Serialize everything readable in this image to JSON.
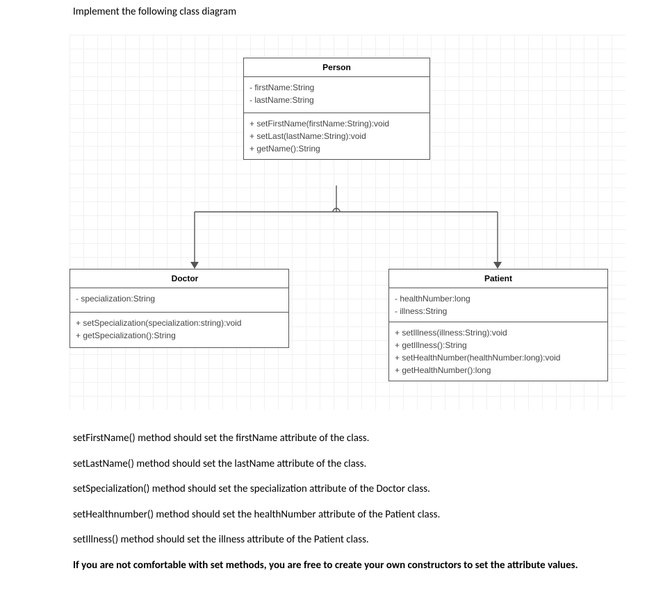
{
  "heading": "Implement the following class diagram",
  "classes": {
    "person": {
      "name": "Person",
      "attributes": [
        "- firstName:String",
        "- lastName:String"
      ],
      "methods": [
        "+ setFirstName(firstName:String):void",
        "+ setLast(lastName:String):void",
        "+ getName():String"
      ]
    },
    "doctor": {
      "name": "Doctor",
      "attributes": [
        "- specialization:String"
      ],
      "methods": [
        "+ setSpecialization(specialization:string):void",
        "+ getSpecialization():String"
      ]
    },
    "patient": {
      "name": "Patient",
      "attributes": [
        "- healthNumber:long",
        "- illness:String"
      ],
      "methods": [
        "+ setIllness(illness:String):void",
        "+ getIllness():String",
        "+ setHealthNumber(healthNumber:long):void",
        "+ getHealthNumber():long"
      ]
    }
  },
  "relationships": [
    {
      "from": "Doctor",
      "to": "Person",
      "kind": "inheritance"
    },
    {
      "from": "Patient",
      "to": "Person",
      "kind": "inheritance"
    }
  ],
  "description": {
    "p1": "setFirstName() method should set the firstName attribute of the class.",
    "p2": "setLastName() method should set the lastName attribute of the class.",
    "p3": "setSpecialization() method should set the specialization attribute of the Doctor class.",
    "p4": "setHealthnumber() method should set the healthNumber attribute of the Patient class.",
    "p5": "setIllness() method should set the illness attribute of the Patient class.",
    "p6": "If you are not comfortable with set methods, you are free to create your own constructors to set the attribute values."
  },
  "chart_data": {
    "type": "uml_class_diagram",
    "classes": [
      {
        "name": "Person",
        "attributes": [
          {
            "visibility": "private",
            "name": "firstName",
            "type": "String"
          },
          {
            "visibility": "private",
            "name": "lastName",
            "type": "String"
          }
        ],
        "methods": [
          {
            "visibility": "public",
            "name": "setFirstName",
            "params": [
              {
                "name": "firstName",
                "type": "String"
              }
            ],
            "return": "void"
          },
          {
            "visibility": "public",
            "name": "setLast",
            "params": [
              {
                "name": "lastName",
                "type": "String"
              }
            ],
            "return": "void"
          },
          {
            "visibility": "public",
            "name": "getName",
            "params": [],
            "return": "String"
          }
        ]
      },
      {
        "name": "Doctor",
        "extends": "Person",
        "attributes": [
          {
            "visibility": "private",
            "name": "specialization",
            "type": "String"
          }
        ],
        "methods": [
          {
            "visibility": "public",
            "name": "setSpecialization",
            "params": [
              {
                "name": "specialization",
                "type": "string"
              }
            ],
            "return": "void"
          },
          {
            "visibility": "public",
            "name": "getSpecialization",
            "params": [],
            "return": "String"
          }
        ]
      },
      {
        "name": "Patient",
        "extends": "Person",
        "attributes": [
          {
            "visibility": "private",
            "name": "healthNumber",
            "type": "long"
          },
          {
            "visibility": "private",
            "name": "illness",
            "type": "String"
          }
        ],
        "methods": [
          {
            "visibility": "public",
            "name": "setIllness",
            "params": [
              {
                "name": "illness",
                "type": "String"
              }
            ],
            "return": "void"
          },
          {
            "visibility": "public",
            "name": "getIllness",
            "params": [],
            "return": "String"
          },
          {
            "visibility": "public",
            "name": "setHealthNumber",
            "params": [
              {
                "name": "healthNumber",
                "type": "long"
              }
            ],
            "return": "void"
          },
          {
            "visibility": "public",
            "name": "getHealthNumber",
            "params": [],
            "return": "long"
          }
        ]
      }
    ],
    "relationships": [
      {
        "from": "Doctor",
        "to": "Person",
        "kind": "inheritance"
      },
      {
        "from": "Patient",
        "to": "Person",
        "kind": "inheritance"
      }
    ]
  }
}
